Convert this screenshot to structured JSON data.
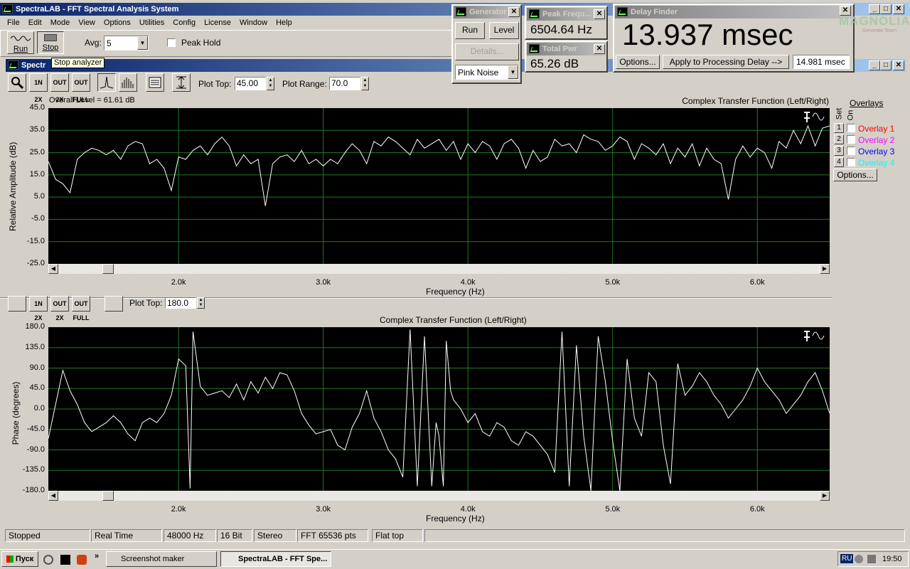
{
  "main_window": {
    "title": "SpectraLAB - FFT Spectral Analysis System",
    "menu": [
      "File",
      "Edit",
      "Mode",
      "View",
      "Options",
      "Utilities",
      "Config",
      "License",
      "Window",
      "Help"
    ],
    "run_label": "Run",
    "stop_label": "Stop",
    "avg_label": "Avg:",
    "avg_value": "5",
    "peak_hold_label": "Peak Hold",
    "tooltip": "Stop analyzer"
  },
  "child_window": {
    "title": "Spectr",
    "plot_top_label": "Plot Top:",
    "plot_top_value": "45.00",
    "plot_range_label": "Plot Range:",
    "plot_range_value": "70.0",
    "plot_top2_label": "Plot Top:",
    "plot_top2_value": "180.0",
    "zoom_icons": [
      "1N 2X",
      "OUT 2X",
      "OUT FULL"
    ]
  },
  "generator": {
    "title": "Generator",
    "run_label": "Run",
    "level_label": "Level",
    "details_label": "Details...",
    "signal": "Pink Noise"
  },
  "peak_freq": {
    "title": "Peak Frequ...",
    "value": "6504.64 Hz"
  },
  "total_pwr": {
    "title": "Total Pwr",
    "value": "65.26 dB"
  },
  "delay_finder": {
    "title": "Delay Finder",
    "value": "13.937 msec",
    "options_label": "Options...",
    "apply_label": "Apply to Processing Delay -->",
    "field_value": "14.981 msec"
  },
  "watermark": {
    "text": "MAGNOLIA",
    "sub": "Generate Team"
  },
  "overlays": {
    "title": "Overlays",
    "set_label": "Set",
    "on_label": "On",
    "items": [
      {
        "num": "1",
        "label": "Overlay 1",
        "color": "#ff0000"
      },
      {
        "num": "2",
        "label": "Overlay 2",
        "color": "#ff00ff"
      },
      {
        "num": "3",
        "label": "Overlay 3",
        "color": "#0000ff"
      },
      {
        "num": "4",
        "label": "Overlay 4",
        "color": "#00ffff"
      }
    ],
    "options_label": "Options..."
  },
  "status_bar": [
    "Stopped",
    "Real Time",
    "48000 Hz",
    "16 Bit",
    "Stereo",
    "FFT 65536 pts",
    "Flat top"
  ],
  "taskbar": {
    "start": "Пуск",
    "tasks": [
      "Screenshot maker",
      "SpectraLAB - FFT Spe..."
    ],
    "lang": "RU",
    "time": "19:50"
  },
  "chart_data": [
    {
      "type": "line",
      "title": "Complex Transfer Function (Left/Right)",
      "overall_level": "Overall Level = 61.61 dB",
      "xlabel": "Frequency (Hz)",
      "ylabel": "Relative Amplitude (dB)",
      "ylim": [
        -25,
        45
      ],
      "xlim": [
        1100,
        6500
      ],
      "y_ticks": [
        "45.0",
        "35.0",
        "25.0",
        "15.0",
        "5.0",
        "-5.0",
        "-15.0",
        "-25.0"
      ],
      "x_ticks": [
        {
          "label": "2.0k",
          "value": 2000
        },
        {
          "label": "3.0k",
          "value": 3000
        },
        {
          "label": "4.0k",
          "value": 4000
        },
        {
          "label": "5.0k",
          "value": 5000
        },
        {
          "label": "6.0k",
          "value": 6000
        }
      ],
      "grid": true,
      "series": [
        {
          "x": [
            1100,
            1150,
            1200,
            1250,
            1300,
            1350,
            1400,
            1450,
            1500,
            1550,
            1600,
            1650,
            1700,
            1750,
            1800,
            1850,
            1900,
            1950,
            2000,
            2050,
            2100,
            2150,
            2200,
            2250,
            2300,
            2350,
            2400,
            2450,
            2500,
            2550,
            2600,
            2650,
            2700,
            2750,
            2800,
            2850,
            2900,
            2950,
            3000,
            3050,
            3100,
            3150,
            3200,
            3250,
            3300,
            3350,
            3400,
            3450,
            3500,
            3550,
            3600,
            3650,
            3700,
            3750,
            3800,
            3850,
            3900,
            3950,
            4000,
            4050,
            4100,
            4150,
            4200,
            4250,
            4300,
            4350,
            4400,
            4450,
            4500,
            4550,
            4600,
            4650,
            4700,
            4750,
            4800,
            4850,
            4900,
            4950,
            5000,
            5050,
            5100,
            5150,
            5200,
            5250,
            5300,
            5350,
            5400,
            5450,
            5500,
            5550,
            5600,
            5650,
            5700,
            5750,
            5800,
            5850,
            5900,
            5950,
            6000,
            6050,
            6100,
            6150,
            6200,
            6250,
            6300,
            6350,
            6400,
            6450,
            6500
          ],
          "values": [
            21,
            13,
            11,
            7,
            22,
            25,
            27,
            26,
            24,
            26,
            22,
            28,
            30,
            29,
            20,
            22,
            18,
            8,
            23,
            22,
            26,
            28,
            24,
            29,
            32,
            28,
            19,
            24,
            20,
            22,
            1,
            20,
            23,
            24,
            21,
            26,
            20,
            22,
            19,
            22,
            20,
            25,
            29,
            26,
            20,
            30,
            28,
            32,
            30,
            27,
            24,
            31,
            27,
            29,
            31,
            26,
            30,
            22,
            29,
            25,
            30,
            28,
            22,
            29,
            31,
            27,
            18,
            26,
            21,
            23,
            31,
            28,
            29,
            25,
            33,
            31,
            30,
            26,
            28,
            32,
            30,
            22,
            29,
            27,
            24,
            29,
            20,
            27,
            23,
            29,
            19,
            27,
            22,
            20,
            4,
            22,
            28,
            23,
            27,
            25,
            18,
            30,
            27,
            35,
            29,
            37,
            28,
            36,
            37
          ]
        }
      ]
    },
    {
      "type": "line",
      "title": "Complex Transfer Function (Left/Right)",
      "xlabel": "Frequency (Hz)",
      "ylabel": "Phase (degrees)",
      "ylim": [
        -180,
        180
      ],
      "xlim": [
        1100,
        6500
      ],
      "y_ticks": [
        "180.0",
        "135.0",
        "90.0",
        "45.0",
        "0.0",
        "-45.0",
        "-90.0",
        "-135.0",
        "-180.0"
      ],
      "x_ticks": [
        {
          "label": "2.0k",
          "value": 2000
        },
        {
          "label": "3.0k",
          "value": 3000
        },
        {
          "label": "4.0k",
          "value": 4000
        },
        {
          "label": "5.0k",
          "value": 5000
        },
        {
          "label": "6.0k",
          "value": 6000
        }
      ],
      "grid": true,
      "series": [
        {
          "x": [
            1100,
            1150,
            1200,
            1250,
            1300,
            1350,
            1400,
            1450,
            1500,
            1550,
            1600,
            1650,
            1700,
            1750,
            1800,
            1850,
            1900,
            1950,
            2000,
            2050,
            2080,
            2100,
            2150,
            2200,
            2250,
            2300,
            2350,
            2400,
            2450,
            2500,
            2550,
            2600,
            2650,
            2700,
            2750,
            2800,
            2850,
            2900,
            2950,
            3000,
            3050,
            3100,
            3150,
            3200,
            3250,
            3300,
            3350,
            3400,
            3450,
            3500,
            3550,
            3600,
            3650,
            3700,
            3750,
            3780,
            3800,
            3830,
            3850,
            3880,
            3900,
            3950,
            4000,
            4050,
            4100,
            4150,
            4200,
            4250,
            4300,
            4350,
            4400,
            4450,
            4500,
            4550,
            4600,
            4650,
            4700,
            4750,
            4800,
            4850,
            4900,
            4950,
            5000,
            5050,
            5100,
            5150,
            5200,
            5250,
            5300,
            5350,
            5400,
            5450,
            5500,
            5550,
            5600,
            5650,
            5700,
            5750,
            5800,
            5850,
            5900,
            5950,
            6000,
            6050,
            6100,
            6150,
            6200,
            6250,
            6300,
            6350,
            6400,
            6450,
            6500
          ],
          "values": [
            -65,
            10,
            85,
            40,
            10,
            -30,
            -50,
            -40,
            -30,
            -15,
            -30,
            -55,
            -70,
            -30,
            -20,
            -30,
            -10,
            30,
            110,
            95,
            -175,
            170,
            50,
            30,
            35,
            40,
            25,
            55,
            20,
            60,
            35,
            70,
            45,
            80,
            75,
            40,
            -10,
            -35,
            -55,
            -50,
            -45,
            -80,
            -90,
            -40,
            -10,
            40,
            -20,
            -50,
            -90,
            -110,
            -150,
            175,
            -170,
            160,
            -170,
            -30,
            -60,
            -170,
            150,
            40,
            20,
            0,
            -30,
            -10,
            -50,
            -60,
            -30,
            -40,
            -70,
            -80,
            -50,
            -60,
            -80,
            -100,
            -140,
            170,
            -170,
            140,
            -60,
            -180,
            160,
            60,
            -70,
            -180,
            110,
            -20,
            -60,
            80,
            60,
            -80,
            -165,
            100,
            30,
            50,
            80,
            60,
            30,
            10,
            -20,
            0,
            20,
            50,
            90,
            60,
            40,
            20,
            -10,
            10,
            30,
            60,
            80,
            40,
            -10
          ]
        }
      ]
    }
  ]
}
